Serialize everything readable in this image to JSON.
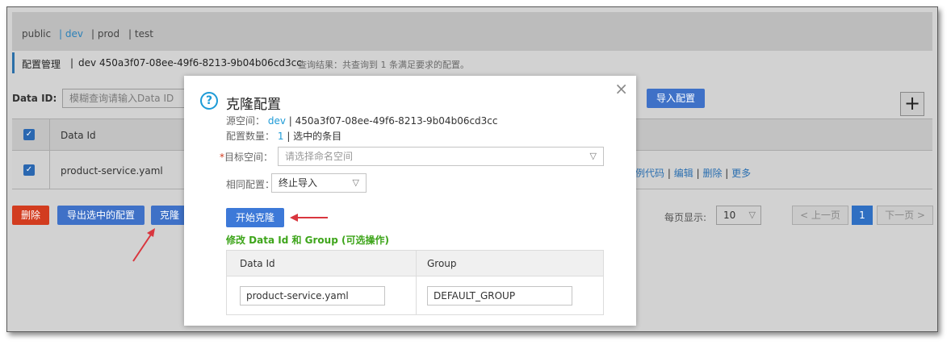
{
  "namespaces": {
    "public": "public",
    "dev": "| dev",
    "prod": "| prod",
    "test": "| test"
  },
  "header": {
    "title": "配置管理",
    "separator": "|",
    "namespace": "dev",
    "namespace_id": "450a3f07-08ee-49f6-8213-9b04b06cd3cc",
    "result": "查询结果：共查询到 1 条满足要求的配置。"
  },
  "search": {
    "label": "Data ID:",
    "placeholder": "模糊查询请输入Data ID"
  },
  "toolbar": {
    "import_label": "导入配置",
    "plus": "+"
  },
  "table": {
    "col_data_id": "Data Id",
    "row_data_id": "product-service.yaml",
    "action_example": "示例代码",
    "action_edit": "编辑",
    "action_delete": "删除",
    "action_more": "更多",
    "sep": "|"
  },
  "bottom": {
    "delete_label": "删除",
    "export_label": "导出选中的配置",
    "clone_label": "克隆",
    "page_size_label": "每页显示:",
    "page_size_value": "10",
    "prev_label": "< 上一页",
    "page_number": "1",
    "next_label": "下一页 >"
  },
  "modal": {
    "close": "×",
    "help": "?",
    "title": "克隆配置",
    "source_label": "源空间：",
    "source_ns": "dev",
    "source_rest": "| 450a3f07-08ee-49f6-8213-9b04b06cd3cc",
    "count_label": "配置数量：",
    "count_value": "1",
    "count_rest": "| 选中的条目",
    "target_required": "*",
    "target_label": "目标空间：",
    "target_placeholder": "请选择命名空间",
    "same_label": "相同配置：",
    "same_value": "终止导入",
    "start_label": "开始克隆",
    "modify_title": "修改 Data Id 和 Group (可选操作)",
    "col_data_id": "Data Id",
    "col_group": "Group",
    "data_id_value": "product-service.yaml",
    "group_value": "DEFAULT_GROUP"
  },
  "colors": {
    "accent_blue": "#3d79d8",
    "danger_red": "#d23c1f",
    "link_blue": "#1e9bd7",
    "success_green": "#3ea51b",
    "annotation_arrow": "#d9363e"
  }
}
